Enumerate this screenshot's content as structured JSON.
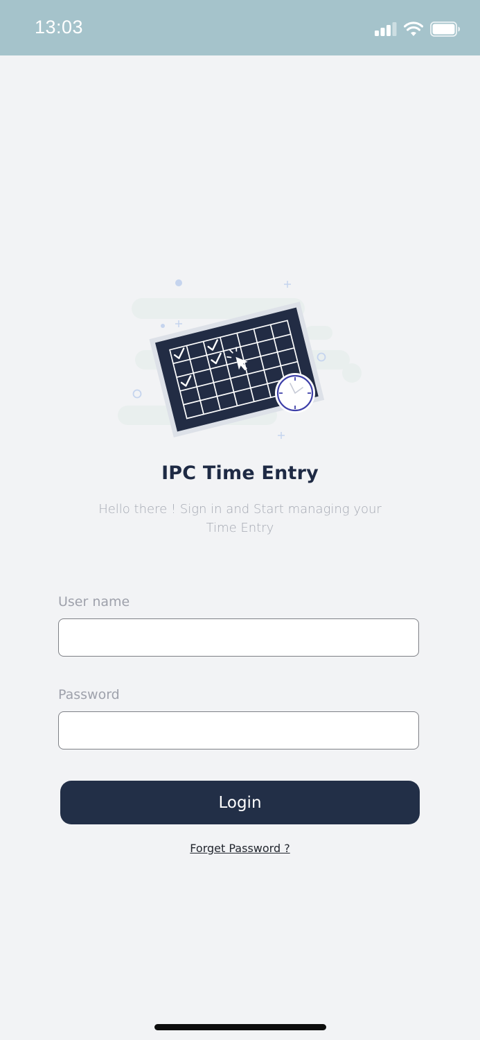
{
  "status_bar": {
    "time": "13:03",
    "icons": [
      "signal-icon",
      "wifi-icon",
      "battery-icon"
    ]
  },
  "app": {
    "title": "IPC Time Entry",
    "subtitle": "Hello there ! Sign in and Start managing your Time Entry"
  },
  "form": {
    "username_label": "User name",
    "username_value": "",
    "password_label": "Password",
    "password_value": "",
    "login_label": "Login",
    "forgot_label": "Forget Password ?"
  },
  "colors": {
    "status_bar": "#a5c3cb",
    "background": "#f2f3f5",
    "primary": "#222f47",
    "accent": "#3d3fa8"
  }
}
